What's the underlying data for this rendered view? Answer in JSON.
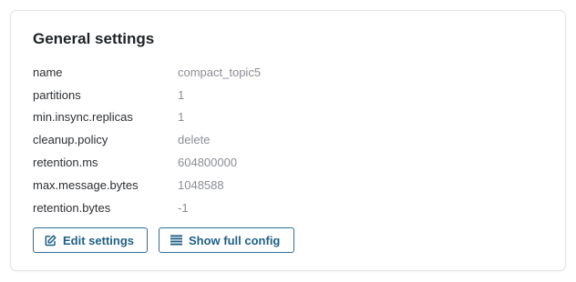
{
  "card": {
    "title": "General settings",
    "settings": [
      {
        "key": "name",
        "value": "compact_topic5"
      },
      {
        "key": "partitions",
        "value": "1"
      },
      {
        "key": "min.insync.replicas",
        "value": "1"
      },
      {
        "key": "cleanup.policy",
        "value": "delete"
      },
      {
        "key": "retention.ms",
        "value": "604800000"
      },
      {
        "key": "max.message.bytes",
        "value": "1048588"
      },
      {
        "key": "retention.bytes",
        "value": "-1"
      }
    ],
    "actions": {
      "edit_label": "Edit settings",
      "edit_icon": "edit-icon",
      "config_label": "Show full config",
      "config_icon": "list-icon"
    }
  },
  "colors": {
    "accent": "#1f5f85",
    "border": "#e3e3e3",
    "value_text": "#8b8d95"
  }
}
